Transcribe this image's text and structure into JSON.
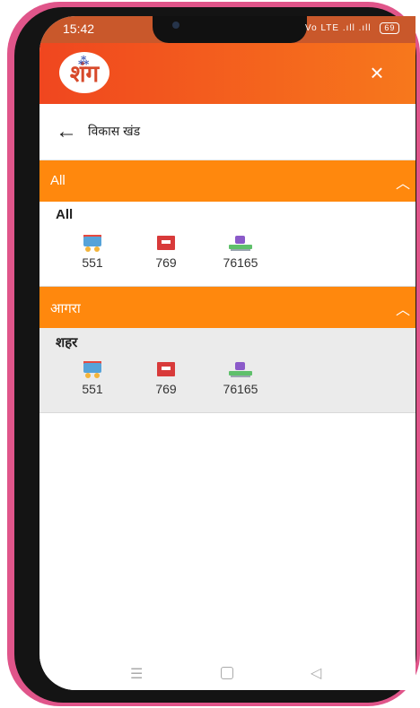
{
  "status_bar": {
    "time": "15:42",
    "signal": "Vo LTE .ıll .ıll",
    "battery": "69"
  },
  "header": {
    "logo_text": "शंग",
    "close_icon": "close-icon"
  },
  "subheader": {
    "back_icon": "back-arrow-icon",
    "title": "विकास खंड"
  },
  "sections": [
    {
      "title": "All",
      "row_title": "All",
      "row_background": "#ffffff",
      "stats": [
        {
          "icon": "train-icon",
          "value": "551"
        },
        {
          "icon": "book-icon",
          "value": "769"
        },
        {
          "icon": "school-desk-icon",
          "value": "76165"
        }
      ]
    },
    {
      "title": "आगरा",
      "row_title": "शहर",
      "row_background": "#ebebeb",
      "stats": [
        {
          "icon": "train-icon",
          "value": "551"
        },
        {
          "icon": "book-icon",
          "value": "769"
        },
        {
          "icon": "school-desk-icon",
          "value": "76165"
        }
      ]
    }
  ],
  "nav_bar": {
    "menu_icon": "☰",
    "home_icon": "home-icon",
    "back_icon": "◁"
  },
  "colors": {
    "accent": "#ff880d",
    "header_start": "#f0461f",
    "header_end": "#f7781c"
  }
}
